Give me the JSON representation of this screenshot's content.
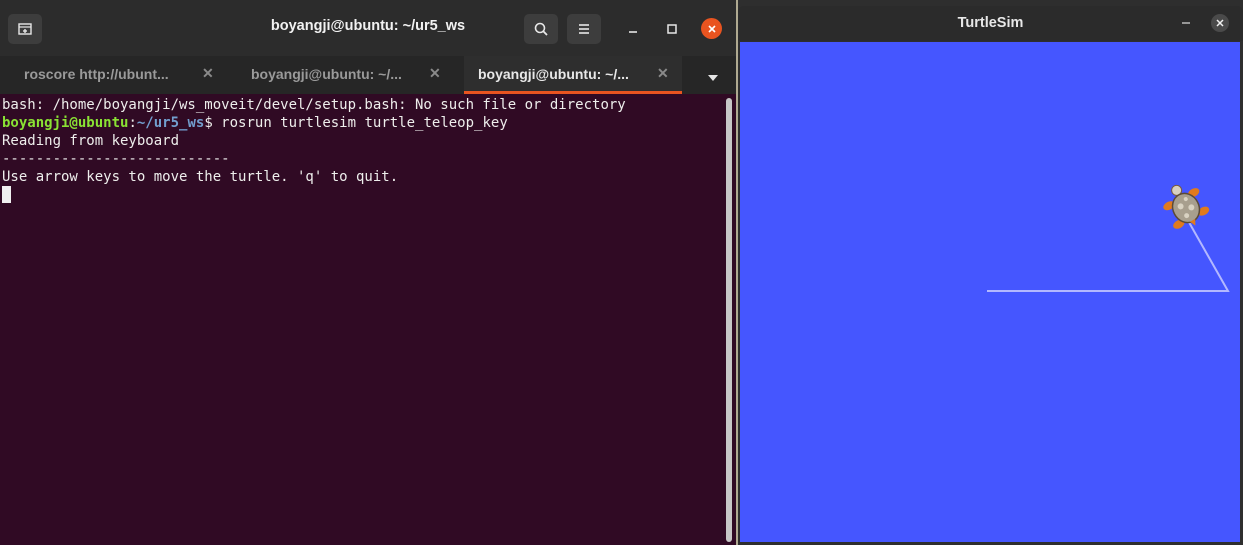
{
  "terminal": {
    "title": "boyangji@ubuntu: ~/ur5_ws",
    "tabs": [
      {
        "label": "roscore http://ubunt...",
        "active": false
      },
      {
        "label": "boyangji@ubuntu: ~/...",
        "active": false
      },
      {
        "label": "boyangji@ubuntu: ~/...",
        "active": true
      }
    ],
    "lines": {
      "error": "bash: /home/boyangji/ws_moveit/devel/setup.bash: No such file or directory",
      "prompt_user": "boyangji@ubuntu",
      "prompt_colon": ":",
      "prompt_path": "~/ur5_ws",
      "prompt_dollar": "$ ",
      "command": "rosrun turtlesim turtle_teleop_key",
      "reading": "Reading from keyboard",
      "divider": "---------------------------",
      "instructions": "Use arrow keys to move the turtle. 'q' to quit."
    },
    "colors": {
      "background": "#300a24",
      "accent": "#e95420",
      "prompt_user": "#8ae234",
      "prompt_path": "#729fcf"
    },
    "icons": [
      "new-tab-icon",
      "search-icon",
      "hamburger-menu-icon",
      "minimize-icon",
      "maximize-icon",
      "close-icon",
      "tab-close-icon",
      "chevron-down-icon"
    ]
  },
  "turtlesim": {
    "title": "TurtleSim",
    "canvas_color": "#4556ff",
    "trail_color": "#b3b8ff",
    "icons": [
      "minimize-icon",
      "close-icon",
      "turtle-icon"
    ]
  }
}
